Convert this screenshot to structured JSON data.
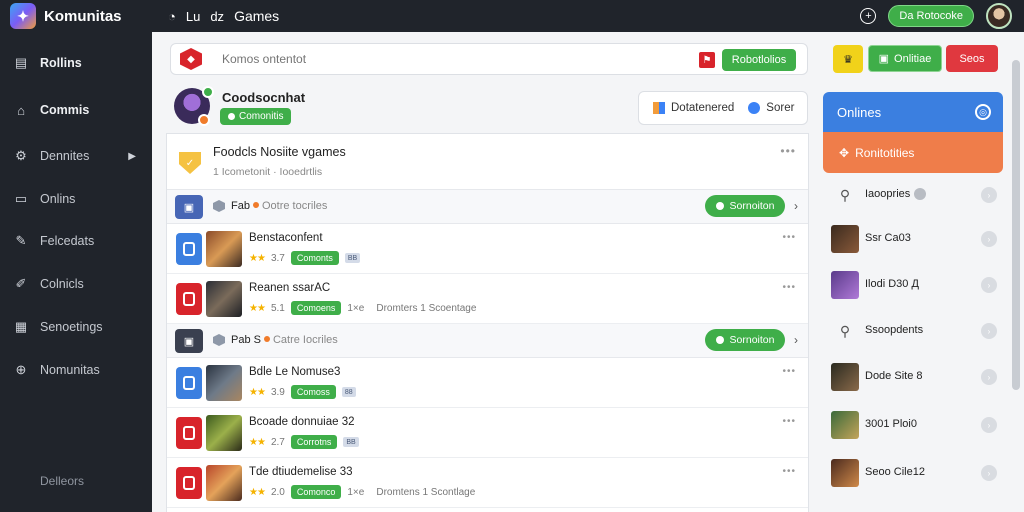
{
  "app": {
    "name": "Komunitas"
  },
  "topbar": {
    "title": "Games",
    "icon_labels": [
      "Lu",
      "dz"
    ],
    "action_button": "Da Rotocoke"
  },
  "sidebar": {
    "items": [
      {
        "label": "Rollins",
        "icon": "document-icon"
      },
      {
        "label": "Commis",
        "icon": "home-icon"
      },
      {
        "label": "Dennites",
        "icon": "cog-icon"
      },
      {
        "label": "Onlins",
        "icon": "list-icon"
      },
      {
        "label": "Felcedats",
        "icon": "pin-icon"
      },
      {
        "label": "Colnicls",
        "icon": "pen-icon"
      },
      {
        "label": "Senoetings",
        "icon": "grid-icon"
      },
      {
        "label": "Nomunitas",
        "icon": "globe-icon"
      }
    ],
    "footer": "Delleors"
  },
  "search": {
    "placeholder": "Komos ontentot",
    "button": "Robotlolios"
  },
  "profile": {
    "name": "Coodsocnhat",
    "badge": "Comonitis"
  },
  "view_toggle": {
    "option1": "Dotatenered",
    "option2": "Sorer"
  },
  "list": {
    "header": {
      "title": "Foodcls Nosiite vgames",
      "subtitle": "1 Icometonit · Iooedrtlis"
    },
    "groups": [
      {
        "icon": "■",
        "title": "Fab",
        "subtitle": "Ootre tocriles",
        "button": "Sornoiton"
      },
      {
        "icon": "■",
        "title": "Pab S",
        "subtitle": "Catre Iocriles",
        "button": "Sornoiton"
      }
    ],
    "rows": [
      {
        "title": "Benstaconfent",
        "rating": "3.7",
        "tag": "Comonts",
        "mini": "BB",
        "extra": "",
        "note": "",
        "color": "#3b7fe0"
      },
      {
        "title": "Reanen ssarAC",
        "rating": "5.1",
        "tag": "Comoens",
        "mini": "",
        "extra": "1×e",
        "note": "Dromters 1 Scoentage",
        "color": "#d8242b"
      },
      {
        "title": "Bdle Le Nomuse3",
        "rating": "3.9",
        "tag": "Comoss",
        "mini": "88",
        "extra": "",
        "note": "",
        "color": "#3b7fe0"
      },
      {
        "title": "Bcoade donnuiae 32",
        "rating": "2.7",
        "tag": "Corrotns",
        "mini": "BB",
        "extra": "",
        "note": "",
        "color": "#d8242b"
      },
      {
        "title": "Tde dtiudemelise 33",
        "rating": "2.0",
        "tag": "Comonco",
        "mini": "",
        "extra": "1×e",
        "note": "Dromtens 1 Scontlage",
        "color": "#d8242b"
      }
    ]
  },
  "right_panel": {
    "btn_online": "Onlitiae",
    "btn_red": "Seos",
    "header_blue": "Onlines",
    "header_orange": "Ronitotities",
    "items": [
      {
        "name": "Iaoopries"
      },
      {
        "name": "Ssr Ca03"
      },
      {
        "name": "Ilodi D30 Д"
      },
      {
        "name": "Ssoopdents"
      },
      {
        "name": "Dode Site 8"
      },
      {
        "name": "3001 Ploi0"
      },
      {
        "name": "Seoo Cile12"
      }
    ]
  },
  "colors": {
    "green": "#3fae49",
    "red": "#d8242b",
    "blue": "#3b7fe0",
    "orange": "#ef7d4a",
    "sidebar": "#20242b"
  }
}
